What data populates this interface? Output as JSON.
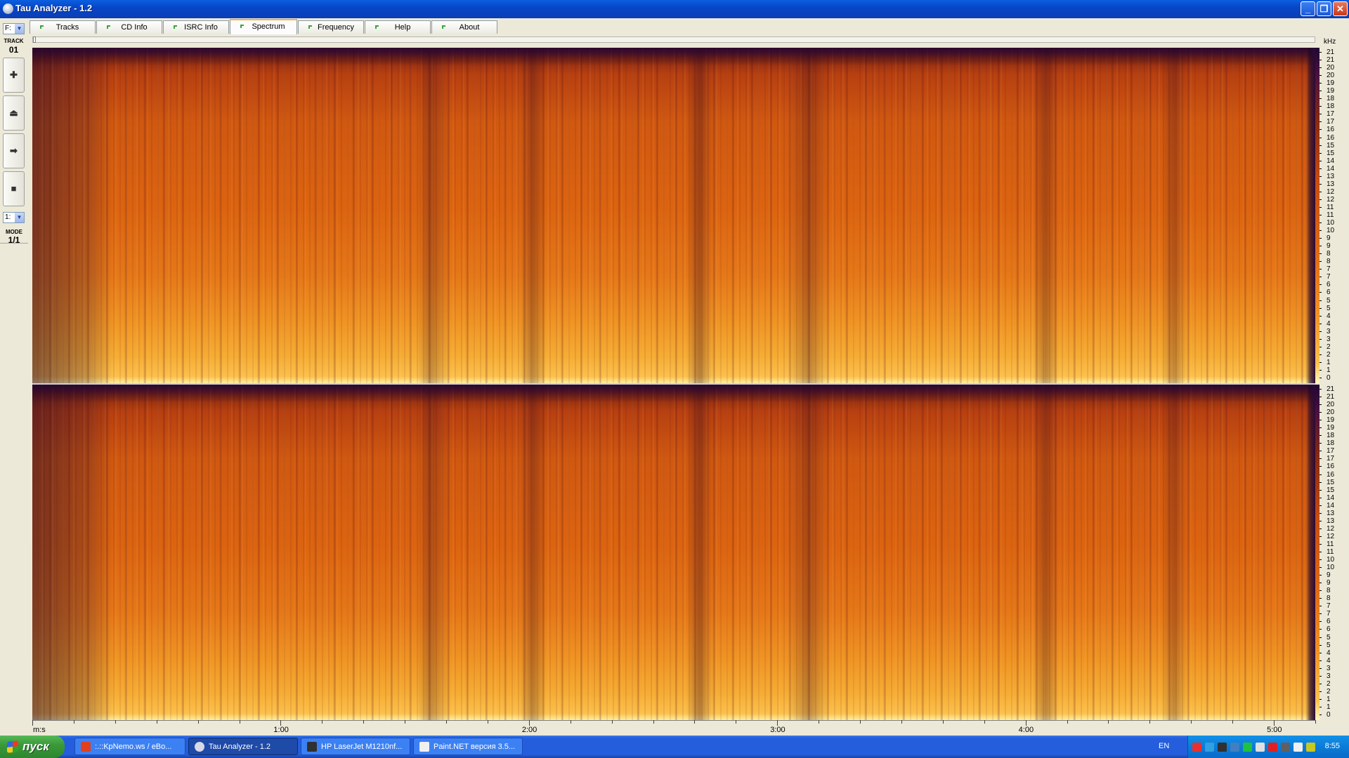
{
  "window": {
    "title": "Tau Analyzer - 1.2",
    "minimize": "_",
    "maximize": "❐",
    "close": "✕"
  },
  "tabs": [
    {
      "label": "Tracks",
      "active": false
    },
    {
      "label": "CD Info",
      "active": false
    },
    {
      "label": "ISRC Info",
      "active": false
    },
    {
      "label": "Spectrum",
      "active": true
    },
    {
      "label": "Frequency",
      "active": false
    },
    {
      "label": "Help",
      "active": false
    },
    {
      "label": "About",
      "active": false
    }
  ],
  "left_panel": {
    "drive": "F:",
    "track_label": "TRACK",
    "track_number": "01",
    "buttons": [
      {
        "name": "add-button",
        "glyph": "✚"
      },
      {
        "name": "eject-button",
        "glyph": "⏏"
      },
      {
        "name": "next-button",
        "glyph": "➡"
      },
      {
        "name": "stop-button",
        "glyph": "■"
      }
    ],
    "mode_select": "1:",
    "mode_label": "MODE",
    "mode_value": "1/1"
  },
  "spectrum": {
    "frequency_unit": "kHz",
    "time_unit": "m:s",
    "freq_ticks": [
      "21",
      "21",
      "20",
      "20",
      "19",
      "19",
      "18",
      "18",
      "17",
      "17",
      "16",
      "16",
      "15",
      "15",
      "14",
      "14",
      "13",
      "13",
      "12",
      "12",
      "11",
      "11",
      "10",
      "10",
      "9",
      "9",
      "8",
      "8",
      "7",
      "7",
      "6",
      "6",
      "5",
      "5",
      "4",
      "4",
      "3",
      "3",
      "2",
      "2",
      "1",
      "1",
      "0"
    ],
    "time_labels": [
      "1:00",
      "2:00",
      "3:00",
      "4:00",
      "5:00"
    ],
    "time_label_seconds": [
      60,
      120,
      180,
      240,
      300
    ],
    "duration_seconds": 310,
    "channels": 2
  },
  "taskbar": {
    "start_label": "пуск",
    "tasks": [
      {
        "label": ":.::KpNemo.ws / eBo...",
        "icon_color": "#e04020",
        "active": false
      },
      {
        "label": "Tau Analyzer - 1.2",
        "icon_color": "#d8d8e8",
        "active": true
      },
      {
        "label": "HP LaserJet M1210nf...",
        "icon_color": "#303030",
        "active": false
      },
      {
        "label": "Paint.NET версия 3.5...",
        "icon_color": "#f0f0f0",
        "active": false
      }
    ],
    "language": "EN",
    "tray_colors": [
      "#e83030",
      "#30a0e0",
      "#303030",
      "#4080c0",
      "#20c040",
      "#e0e0e0",
      "#e02020",
      "#606060",
      "#f0f0f0",
      "#c8c820"
    ],
    "clock": "8:55"
  }
}
